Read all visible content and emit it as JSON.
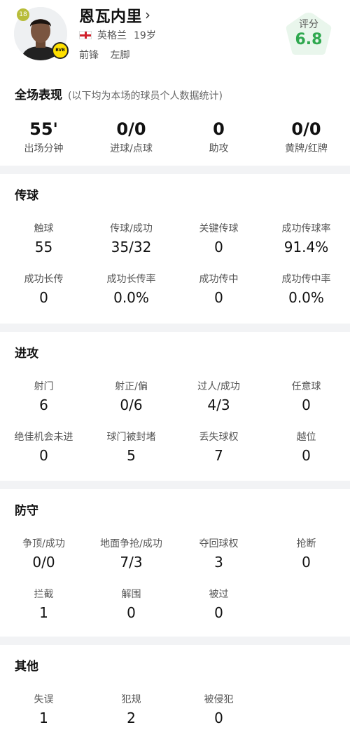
{
  "player": {
    "number": "18",
    "name": "恩瓦内里",
    "country": "英格兰",
    "age": "19岁",
    "position": "前锋",
    "foot": "左脚",
    "club_badge_text": "BVB"
  },
  "rating": {
    "label": "评分",
    "value": "6.8",
    "color": "#2fa84f"
  },
  "overview": {
    "title": "全场表现",
    "note": "(以下均为本场的球员个人数据统计)",
    "stats": [
      {
        "value": "55'",
        "label": "出场分钟"
      },
      {
        "value": "0/0",
        "label": "进球/点球"
      },
      {
        "value": "0",
        "label": "助攻"
      },
      {
        "value": "0/0",
        "label": "黄牌/红牌"
      }
    ]
  },
  "passing": {
    "title": "传球",
    "stats": [
      {
        "label": "触球",
        "value": "55"
      },
      {
        "label": "传球/成功",
        "value": "35/32"
      },
      {
        "label": "关键传球",
        "value": "0"
      },
      {
        "label": "成功传球率",
        "value": "91.4%"
      },
      {
        "label": "成功长传",
        "value": "0"
      },
      {
        "label": "成功长传率",
        "value": "0.0%"
      },
      {
        "label": "成功传中",
        "value": "0"
      },
      {
        "label": "成功传中率",
        "value": "0.0%"
      }
    ]
  },
  "attack": {
    "title": "进攻",
    "stats": [
      {
        "label": "射门",
        "value": "6"
      },
      {
        "label": "射正/偏",
        "value": "0/6"
      },
      {
        "label": "过人/成功",
        "value": "4/3"
      },
      {
        "label": "任意球",
        "value": "0"
      },
      {
        "label": "绝佳机会未进",
        "value": "0"
      },
      {
        "label": "球门被封堵",
        "value": "5"
      },
      {
        "label": "丢失球权",
        "value": "7"
      },
      {
        "label": "越位",
        "value": "0"
      }
    ]
  },
  "defense": {
    "title": "防守",
    "stats": [
      {
        "label": "争顶/成功",
        "value": "0/0"
      },
      {
        "label": "地面争抢/成功",
        "value": "7/3"
      },
      {
        "label": "夺回球权",
        "value": "3"
      },
      {
        "label": "抢断",
        "value": "0"
      },
      {
        "label": "拦截",
        "value": "1"
      },
      {
        "label": "解围",
        "value": "0"
      },
      {
        "label": "被过",
        "value": "0"
      }
    ]
  },
  "other": {
    "title": "其他",
    "stats": [
      {
        "label": "失误",
        "value": "1"
      },
      {
        "label": "犯规",
        "value": "2"
      },
      {
        "label": "被侵犯",
        "value": "0"
      }
    ]
  }
}
